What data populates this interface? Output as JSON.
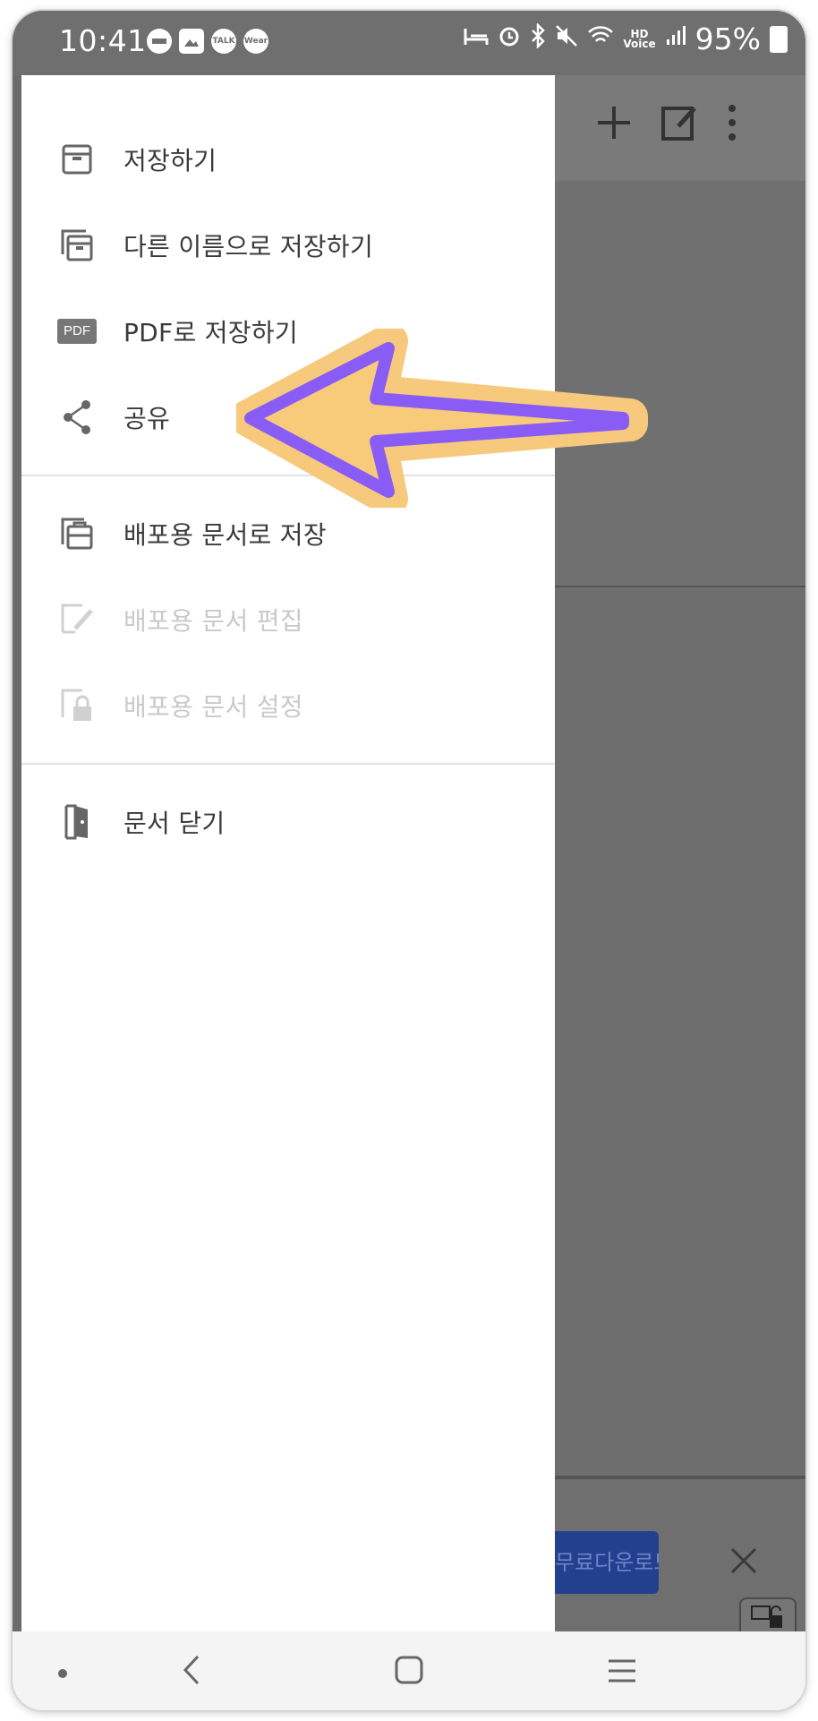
{
  "status_bar": {
    "time": "10:41",
    "left_icons": [
      "dnd-icon",
      "gallery-icon",
      "kakaotalk-icon",
      "wear-icon"
    ],
    "talk_badge": "TALK",
    "wear_badge": "Wear",
    "hd_label_top": "HD",
    "hd_label_bottom": "Voice",
    "battery_percent": "95%"
  },
  "app_toolbar": {
    "icons": [
      "add-icon",
      "edit-icon",
      "more-vert-icon"
    ]
  },
  "drawer": {
    "group1": [
      {
        "label": "저장하기",
        "icon": "save-icon",
        "enabled": true
      },
      {
        "label": "다른 이름으로 저장하기",
        "icon": "save-as-icon",
        "enabled": true
      },
      {
        "label": "PDF로 저장하기",
        "icon": "pdf-icon",
        "enabled": true
      },
      {
        "label": "공유",
        "icon": "share-icon",
        "enabled": true
      }
    ],
    "pdf_icon_text": "PDF",
    "group2": [
      {
        "label": "배포용 문서로 저장",
        "icon": "distribution-save-icon",
        "enabled": true
      },
      {
        "label": "배포용 문서 편집",
        "icon": "distribution-edit-icon",
        "enabled": false
      },
      {
        "label": "배포용 문서 설정",
        "icon": "distribution-lock-icon",
        "enabled": false
      }
    ],
    "group3": [
      {
        "label": "문서 닫기",
        "icon": "close-document-icon",
        "enabled": true
      }
    ]
  },
  "ad_banner": {
    "button_label": "무료다운로드"
  },
  "colors": {
    "arrow_fill": "#8a5cf6",
    "arrow_outline": "#f6c879",
    "overlay": "#6b6b6b",
    "ad_button": "#23408e"
  }
}
